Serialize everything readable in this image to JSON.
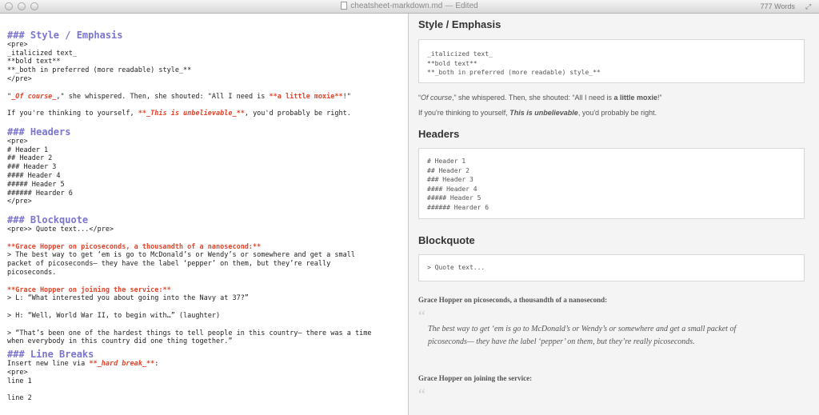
{
  "window": {
    "title": "cheatsheet-markdown.md",
    "status": "Edited",
    "separator": "—",
    "word_count": "777 Words"
  },
  "editor": {
    "style_header": "### Style / Emphasis",
    "pre_open": "<pre>",
    "italic_line": "_italicized text_",
    "bold_line": "**bold text**",
    "both_line": "**_both in preferred (more readable) style_**",
    "pre_close": "</pre>",
    "moxie_a": "\"",
    "moxie_course": "_Of course_",
    "moxie_b": ",\" she whispered. Then, she shouted: \"All I need is ",
    "moxie_strong": "**a little moxie**",
    "moxie_c": "!\"",
    "unbeliev_a": "If you're thinking to yourself, ",
    "unbeliev_em": "**_This is unbelievable_**",
    "unbeliev_b": ", you'd probably be right.",
    "headers_header": "### Headers",
    "h_pre_open": "<pre>",
    "h1": "# Header 1",
    "h2": "## Header 2",
    "h3": "### Header 3",
    "h4": "#### Header 4",
    "h5": "##### Header 5",
    "h6": "###### Hearder 6",
    "h_pre_close": "</pre>",
    "bq_header": "### Blockquote",
    "bq_pre": "<pre>> Quote text...</pre>",
    "gh1_title": "**Grace Hopper on picoseconds, a thousandth of a nanosecond:**",
    "gh1_l1": "> The best way to get ‘em is go to McDonald’s or Wendy’s or somewhere and get a small",
    "gh1_l2": "packet of picoseconds— they have the label ‘pepper’ on them, but they’re really",
    "gh1_l3": "picoseconds.",
    "gh2_title": "**Grace Hopper on joining the service:**",
    "gh2_l1": "> L: “What interested you about going into the Navy at 37?”",
    "gh2_l2": "> H: “Well, World War II, to begin with…” (laughter)",
    "gh2_l3": "> “That’s been one of the hardest things to tell people in this country— there was a time",
    "gh2_l4": "when everybody in this country did one thing together.”",
    "lb_header": "### Line Breaks",
    "lb_a": "Insert new line via ",
    "lb_em": "**_hard break_**",
    "lb_b": ":",
    "lb_pre": "<pre>",
    "lb_l1": "line 1",
    "lb_l2": "line 2"
  },
  "preview": {
    "style_heading": "Style / Emphasis",
    "style_pre_l1": "_italicized text_",
    "style_pre_l2": "**bold text**",
    "style_pre_l3": "**_both in preferred (more readable) style_**",
    "moxie_a": "“",
    "moxie_course": "Of course",
    "moxie_b": ",” she whispered. Then, she shouted: “All I need is ",
    "moxie_strong": "a little moxie",
    "moxie_c": "!”",
    "unbeliev_a": "If you're thinking to yourself, ",
    "unbeliev_em": "This is unbelievable",
    "unbeliev_b": ", you'd probably be right.",
    "headers_heading": "Headers",
    "hdr_pre_l1": "# Header 1",
    "hdr_pre_l2": "## Header 2",
    "hdr_pre_l3": "### Header 3",
    "hdr_pre_l4": "#### Header 4",
    "hdr_pre_l5": "##### Header 5",
    "hdr_pre_l6": "###### Hearder 6",
    "bq_heading": "Blockquote",
    "bq_pre": "> Quote text...",
    "gh1_title": "Grace Hopper on picoseconds, a thousandth of a nanosecond:",
    "gh1_quote_l1": "The best way to get ‘em is go to McDonald’s or Wendy’s or somewhere and get a small packet of",
    "gh1_quote_l2": "picoseconds— they have the label ‘pepper’ on them, but they’re really picoseconds.",
    "gh2_title": "Grace Hopper on joining the service:",
    "quote_mark": "“"
  }
}
